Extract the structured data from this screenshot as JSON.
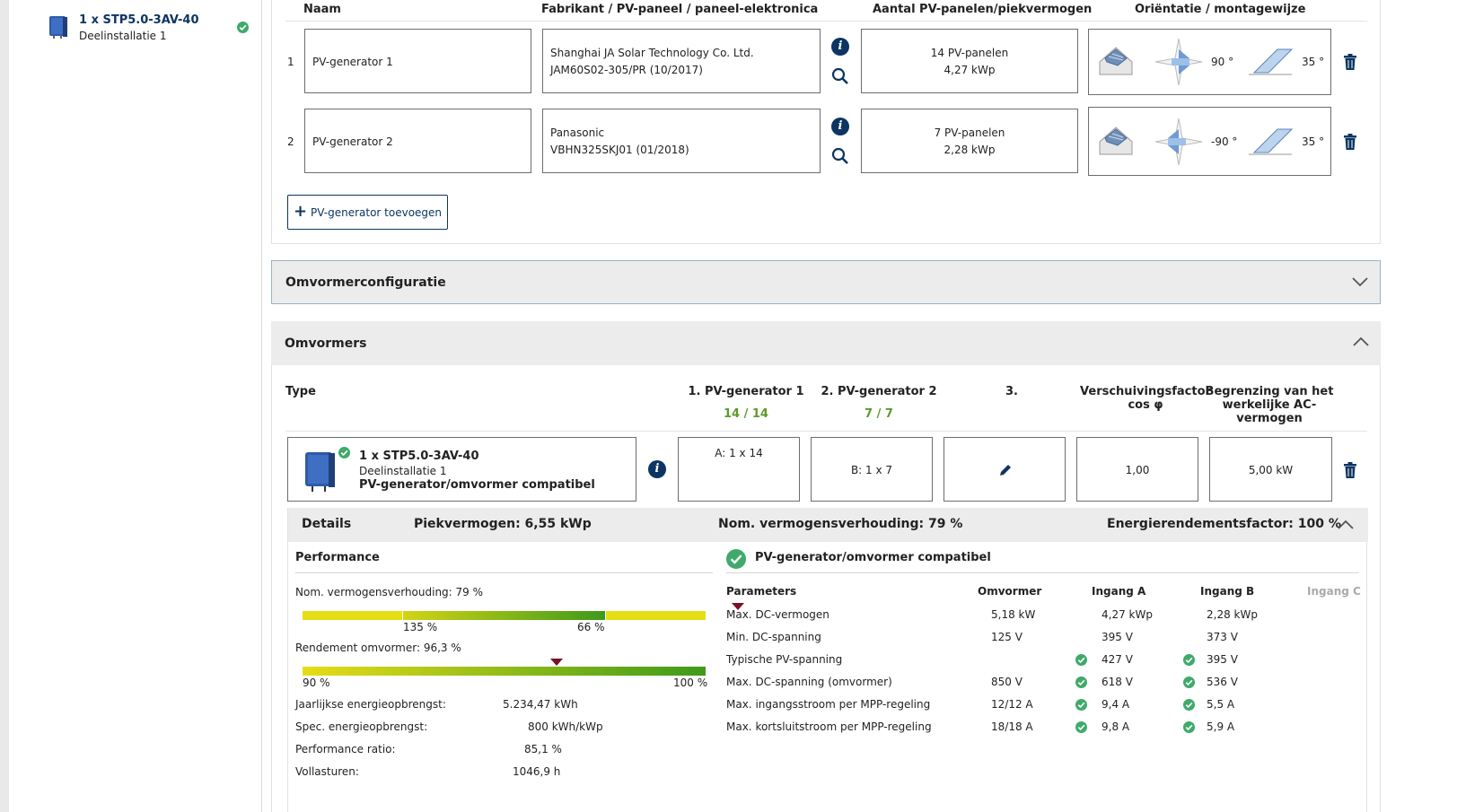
{
  "sidebar": {
    "item_title": "1 x STP5.0-3AV-40",
    "item_sub": "Deelinstallatie 1"
  },
  "pv_table": {
    "headers": {
      "name": "Naam",
      "manufacturer": "Fabrikant / PV-paneel / paneel-elektronica",
      "count": "Aantal PV-panelen/piekvermogen",
      "orientation": "Oriëntatie / montagewijze"
    },
    "rows": [
      {
        "num": "1",
        "name": "PV-generator 1",
        "manufacturer": "Shanghai JA Solar Technology Co. Ltd.",
        "panel": "JAM60S02-305/PR (10/2017)",
        "panels": "14 PV-panelen",
        "power": "4,27 kWp",
        "azimuth": "90 °",
        "tilt": "35 °"
      },
      {
        "num": "2",
        "name": "PV-generator 2",
        "manufacturer": "Panasonic",
        "panel": "VBHN325SKJ01 (01/2018)",
        "panels": "7 PV-panelen",
        "power": "2,28 kWp",
        "azimuth": "-90 °",
        "tilt": "35 °"
      }
    ],
    "add_label": "PV-generator toevoegen"
  },
  "accordions": {
    "config": "Omvormerconfiguratie",
    "inverters": "Omvormers"
  },
  "inverters": {
    "headers": {
      "type": "Type",
      "gen1": "1. PV-generator 1",
      "gen1_count": "14 / 14",
      "gen2": "2. PV-generator 2",
      "gen2_count": "7 / 7",
      "gen3": "3.",
      "cosphi_1": "Verschuivingsfactor",
      "cosphi_2": "cos φ",
      "limit_1": "Begrenzing van het",
      "limit_2": "werkelijke AC-",
      "limit_3": "vermogen"
    },
    "row": {
      "title": "1 x STP5.0-3AV-40",
      "sub": "Deelinstallatie 1",
      "compat": "PV-generator/omvormer compatibel",
      "a": "A: 1 x 14",
      "b": "B: 1 x 7",
      "cosphi": "1,00",
      "limit": "5,00 kW"
    }
  },
  "details": {
    "label": "Details",
    "peak": "Piekvermogen: 6,55 kWp",
    "ratio": "Nom. vermogensverhouding: 79 %",
    "efficiency": "Energierendementsfactor: 100 %",
    "performance": {
      "title": "Performance",
      "ratio_label": "Nom. vermogensverhouding: 79 %",
      "ratio_value": 0.79,
      "ratio_low": "135 %",
      "ratio_high": "66 %",
      "eff_label": "Rendement omvormer: 96,3 %",
      "eff_value": 0.963,
      "eff_low": "90 %",
      "eff_high": "100 %",
      "stats": [
        {
          "label": "Jaarlijkse energieopbrengst:",
          "value": "5.234,47 kWh"
        },
        {
          "label": "Spec. energieopbrengst:",
          "value": "800 kWh/kWp"
        },
        {
          "label": "Performance ratio:",
          "value": "85,1 %"
        },
        {
          "label": "Vollasturen:",
          "value": "1046,9 h"
        }
      ]
    },
    "compat": {
      "title": "PV-generator/omvormer compatibel",
      "columns": [
        "Parameters",
        "Omvormer",
        "Ingang A",
        "Ingang B",
        "Ingang C"
      ],
      "rows": [
        {
          "param": "Max. DC-vermogen",
          "inv": "5,18 kW",
          "a": "4,27 kWp",
          "b": "2,28 kWp"
        },
        {
          "param": "Min. DC-spanning",
          "inv": "125 V",
          "a": "395 V",
          "b": "373 V"
        },
        {
          "param": "Typische PV-spanning",
          "inv": "",
          "a": "427 V",
          "b": "395 V"
        },
        {
          "param": "Max. DC-spanning (omvormer)",
          "inv": "850 V",
          "a": "618 V",
          "b": "536 V"
        },
        {
          "param": "Max. ingangsstroom per MPP-regeling",
          "inv": "12/12 A",
          "a": "9,4 A",
          "b": "5,5 A"
        },
        {
          "param": "Max. kortsluitstroom per MPP-regeling",
          "inv": "18/18 A",
          "a": "9,8 A",
          "b": "5,9 A"
        }
      ]
    }
  }
}
